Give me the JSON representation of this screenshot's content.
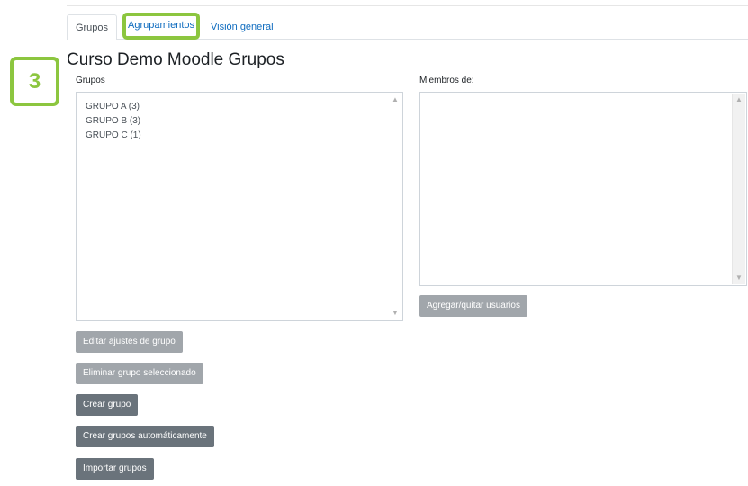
{
  "tabs": {
    "grupos": "Grupos",
    "agrupamientos": "Agrupamientos",
    "vision_general": "Visión general"
  },
  "step_badge": "3",
  "page_title": "Curso Demo Moodle Grupos",
  "groups_panel": {
    "label": "Grupos",
    "options": [
      "GRUPO A (3)",
      "GRUPO B (3)",
      "GRUPO C (1)"
    ]
  },
  "members_panel": {
    "label": "Miembros de:"
  },
  "buttons": {
    "agregar_quitar": "Agregar/quitar usuarios",
    "editar": "Editar ajustes de grupo",
    "eliminar": "Eliminar grupo seleccionado",
    "crear": "Crear grupo",
    "crear_auto": "Crear grupos automáticamente",
    "importar": "Importar grupos"
  },
  "colors": {
    "highlight": "#8cc63f",
    "link": "#0f6cbf",
    "button_dark": "#6a737b",
    "button_disabled": "#a1a6ab"
  },
  "icons": {
    "scroll_up": "chevron-up-icon",
    "scroll_down": "chevron-down-icon"
  }
}
